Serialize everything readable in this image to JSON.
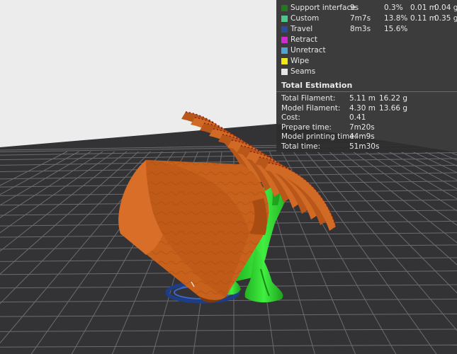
{
  "legend": {
    "rows": [
      {
        "id": "support-interface",
        "label": "Support interface",
        "time": "9s",
        "percent": "0.3%",
        "length": "0.01 m",
        "weight": "0.04 g",
        "color": "#1f7a1f"
      },
      {
        "id": "custom",
        "label": "Custom",
        "time": "7m7s",
        "percent": "13.8%",
        "length": "0.11 m",
        "weight": "0.35 g",
        "color": "#4cc98a"
      },
      {
        "id": "travel",
        "label": "Travel",
        "time": "8m3s",
        "percent": "15.6%",
        "length": "",
        "weight": "",
        "color": "#2c4a9e"
      },
      {
        "id": "retract",
        "label": "Retract",
        "time": "",
        "percent": "",
        "length": "",
        "weight": "",
        "color": "#d12ad1"
      },
      {
        "id": "unretract",
        "label": "Unretract",
        "time": "",
        "percent": "",
        "length": "",
        "weight": "",
        "color": "#4fa3d6"
      },
      {
        "id": "wipe",
        "label": "Wipe",
        "time": "",
        "percent": "",
        "length": "",
        "weight": "",
        "color": "#f2e614"
      },
      {
        "id": "seams",
        "label": "Seams",
        "time": "",
        "percent": "",
        "length": "",
        "weight": "",
        "color": "#e6e6e6"
      }
    ]
  },
  "estimation": {
    "title": "Total Estimation",
    "rows": [
      {
        "id": "total-filament",
        "label": "Total Filament:",
        "value": "5.11 m",
        "value2": "16.22 g"
      },
      {
        "id": "model-filament",
        "label": "Model Filament:",
        "value": "4.30 m",
        "value2": "13.66 g"
      },
      {
        "id": "cost",
        "label": "Cost:",
        "value": "0.41",
        "value2": ""
      },
      {
        "id": "prepare-time",
        "label": "Prepare time:",
        "value": "7m20s",
        "value2": ""
      },
      {
        "id": "model-printing-time",
        "label": "Model printing time:",
        "value": "44m9s",
        "value2": ""
      },
      {
        "id": "total-time",
        "label": "Total time:",
        "value": "51m30s",
        "value2": ""
      }
    ]
  },
  "colors": {
    "model": "#c8611c",
    "support": "#2fd82f",
    "bed": "#333336",
    "backdrop": "#ececec"
  }
}
